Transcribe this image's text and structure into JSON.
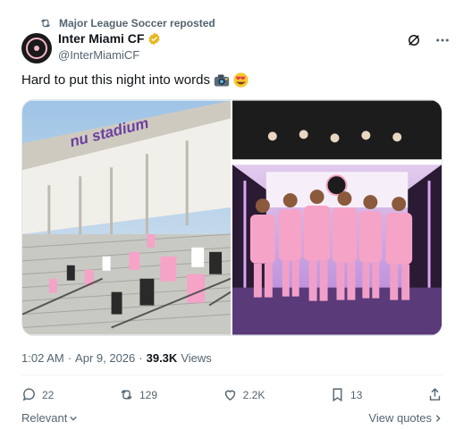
{
  "repost": {
    "text": "Major League Soccer reposted"
  },
  "author": {
    "display_name": "Inter Miami CF",
    "handle": "@InterMiamiCF"
  },
  "tweet": {
    "text": "Hard to put this night into words"
  },
  "media": {
    "stadium_sign": "nu stadium"
  },
  "meta": {
    "time": "1:02 AM",
    "date": "Apr 9, 2026",
    "views_count": "39.3K",
    "views_label": "Views",
    "separator": "·"
  },
  "engagement": {
    "replies": "22",
    "reposts": "129",
    "likes": "2.2K",
    "bookmarks": "13"
  },
  "footer": {
    "relevant": "Relevant",
    "view_quotes": "View quotes"
  },
  "colors": {
    "pink": "#f5a3c7",
    "verified": "#e8b71f",
    "text_secondary": "#536471",
    "accent_purple": "#6b3fa0"
  }
}
